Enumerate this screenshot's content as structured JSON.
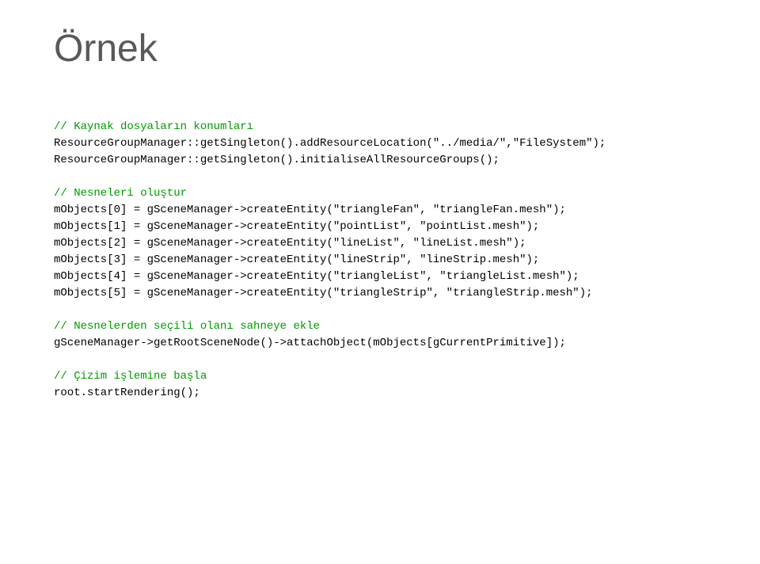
{
  "title": "Örnek",
  "code": {
    "c1": "// Kaynak dosyaların konumları",
    "l1": "ResourceGroupManager::getSingleton().addResourceLocation(\"../media/\",\"FileSystem\");",
    "l2": "ResourceGroupManager::getSingleton().initialiseAllResourceGroups();",
    "c2": "// Nesneleri oluştur",
    "l3": "mObjects[0] = gSceneManager->createEntity(\"triangleFan\", \"triangleFan.mesh\");",
    "l4": "mObjects[1] = gSceneManager->createEntity(\"pointList\", \"pointList.mesh\");",
    "l5": "mObjects[2] = gSceneManager->createEntity(\"lineList\", \"lineList.mesh\");",
    "l6": "mObjects[3] = gSceneManager->createEntity(\"lineStrip\", \"lineStrip.mesh\");",
    "l7": "mObjects[4] = gSceneManager->createEntity(\"triangleList\", \"triangleList.mesh\");",
    "l8": "mObjects[5] = gSceneManager->createEntity(\"triangleStrip\", \"triangleStrip.mesh\");",
    "c3": "// Nesnelerden seçili olanı sahneye ekle",
    "l9": "gSceneManager->getRootSceneNode()->attachObject(mObjects[gCurrentPrimitive]);",
    "c4": "// Çizim işlemine başla",
    "l10": "root.startRendering();"
  }
}
